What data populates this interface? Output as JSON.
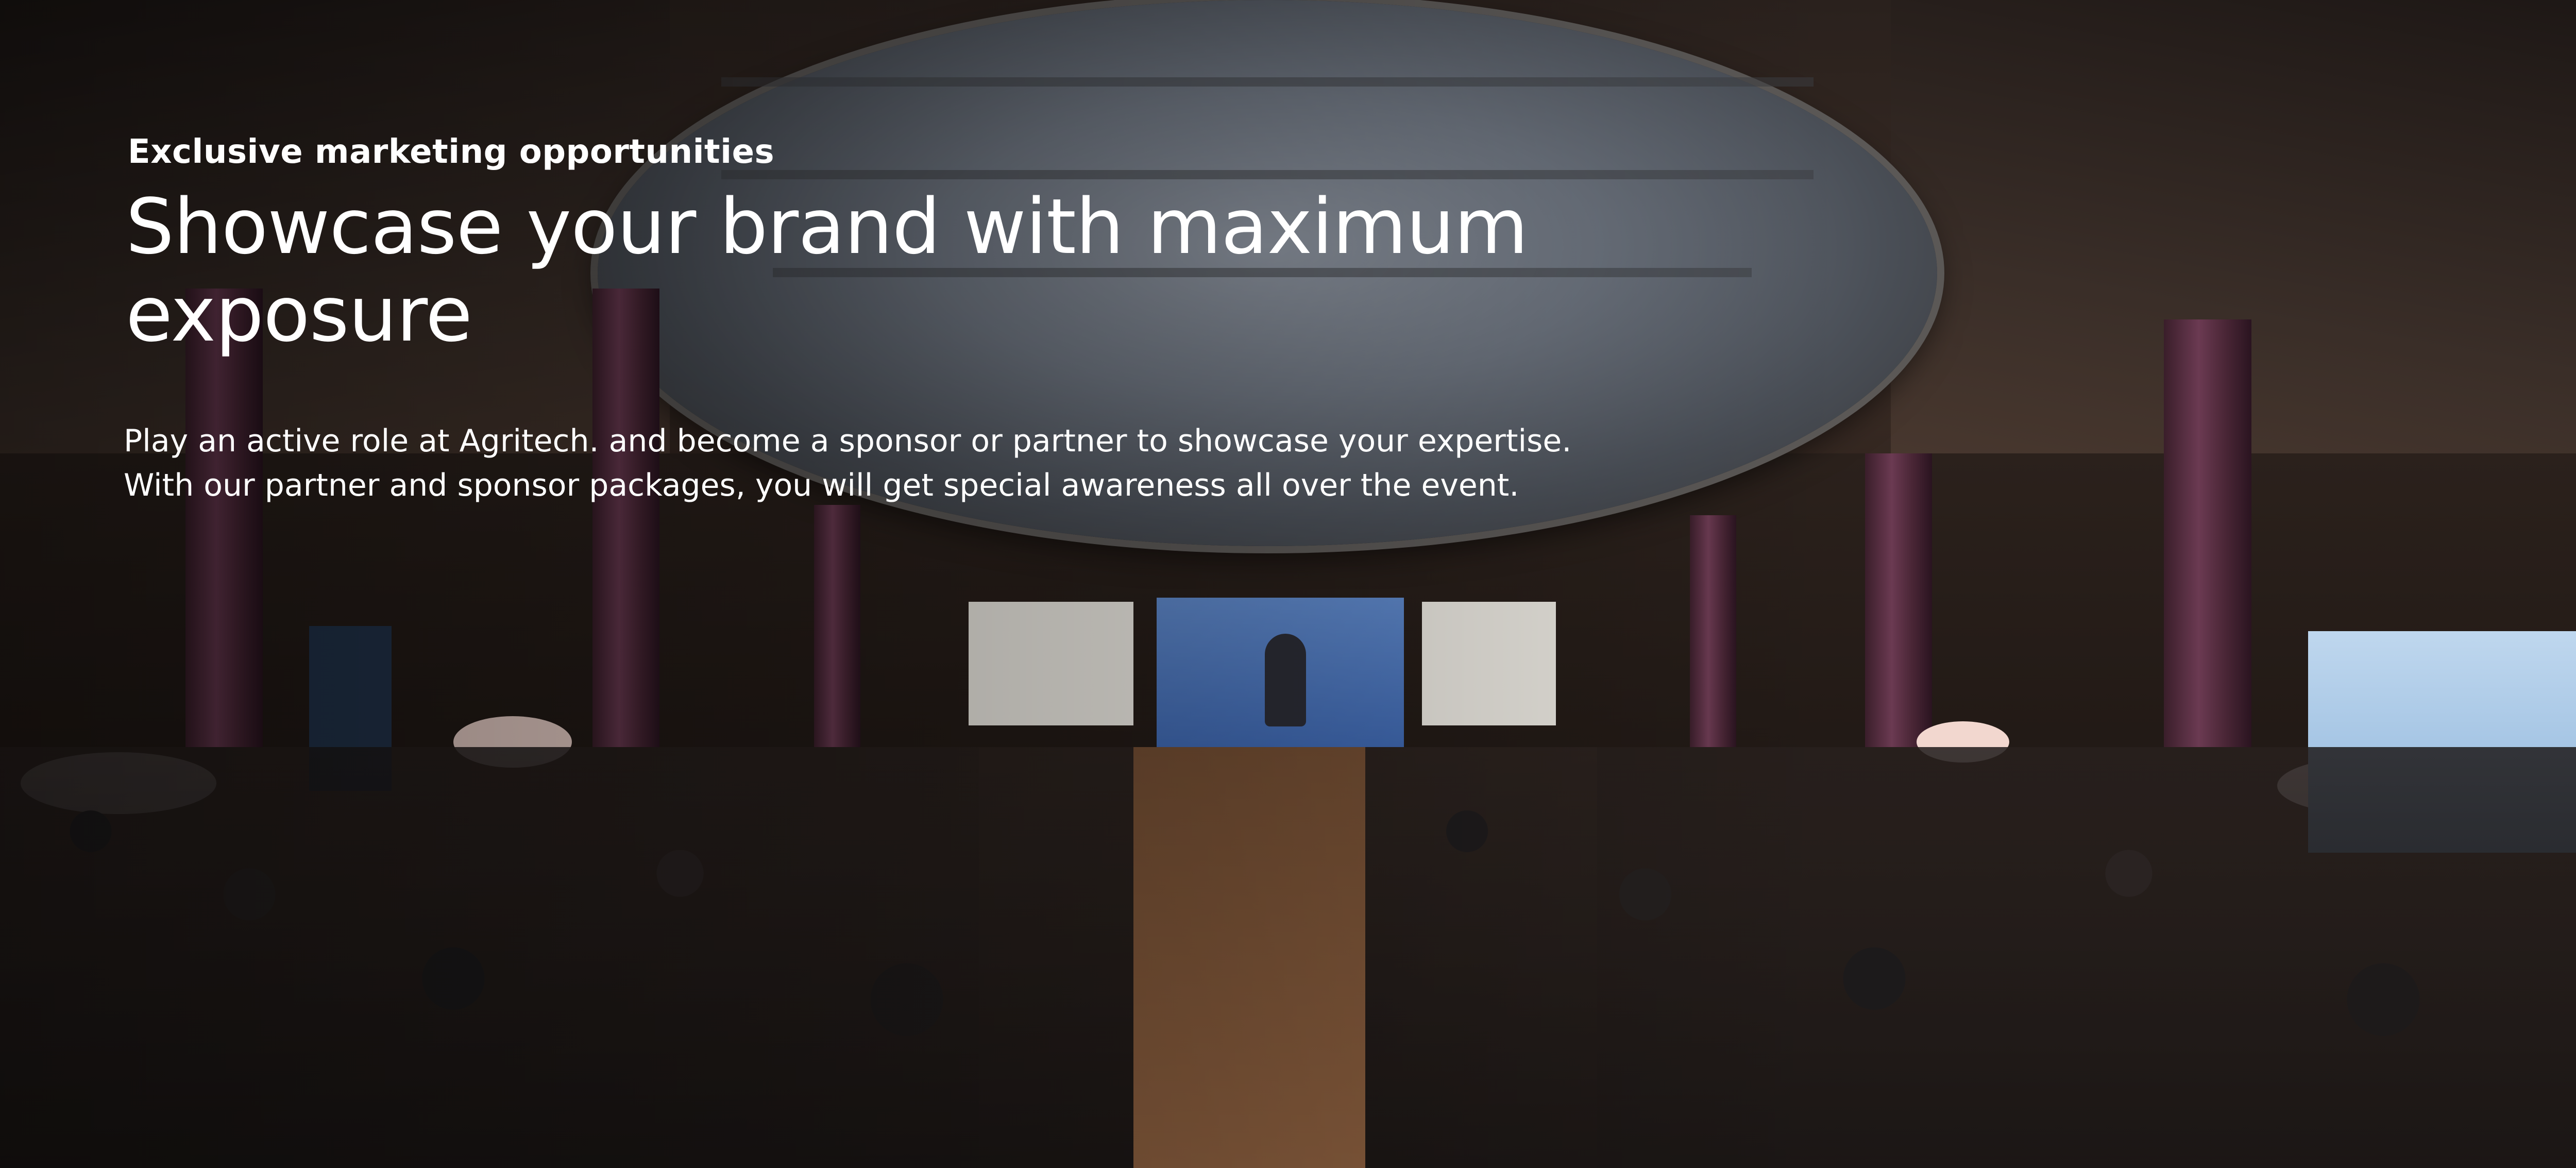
{
  "hero": {
    "eyebrow": "Exclusive marketing opportunities",
    "headline": "Showcase your brand with maximum exposure",
    "body_lines": [
      "Play an active role at Agritech. and become a sponsor or partner to showcase your expertise.",
      "With our partner and sponsor packages, you will get special awareness all over the event."
    ],
    "text_color": "#ffffff",
    "background_image": "conference-hall-photo"
  }
}
